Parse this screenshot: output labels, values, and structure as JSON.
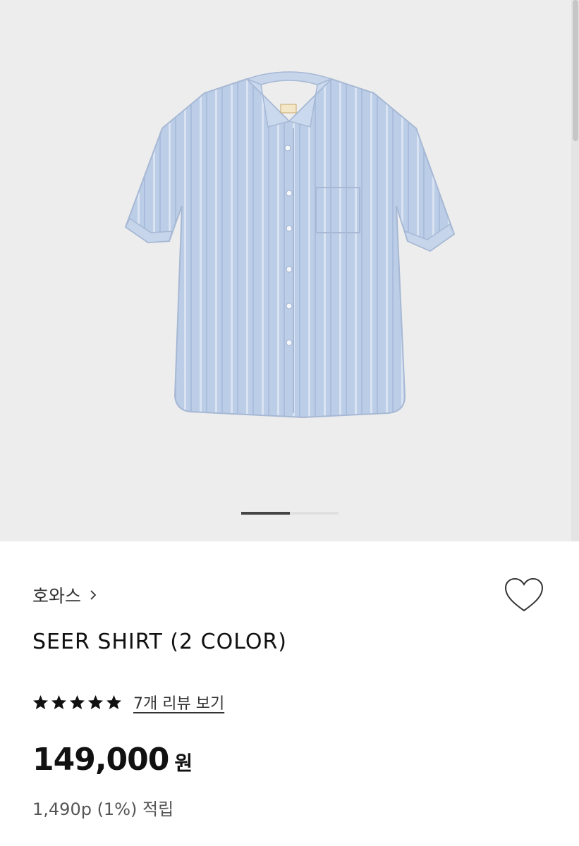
{
  "product": {
    "brand": "호와스",
    "title": "SEER SHIRT (2 COLOR)",
    "rating_stars": 5,
    "review_link": "7개 리뷰 보기",
    "price": "149,000",
    "currency": "원",
    "points": "1,490p (1%) 적립"
  },
  "gallery": {
    "image_count": 2,
    "current_index": 1,
    "image": "blue-striped-short-sleeve-shirt"
  },
  "icons": {
    "wishlist": "heart-outline-icon",
    "brand_link": "chevron-right-icon",
    "star": "star-filled-icon"
  },
  "colors": {
    "hero_background": "#ededed",
    "shirt": "#b9cbe6",
    "text_primary": "#111111",
    "text_secondary": "#555555"
  }
}
